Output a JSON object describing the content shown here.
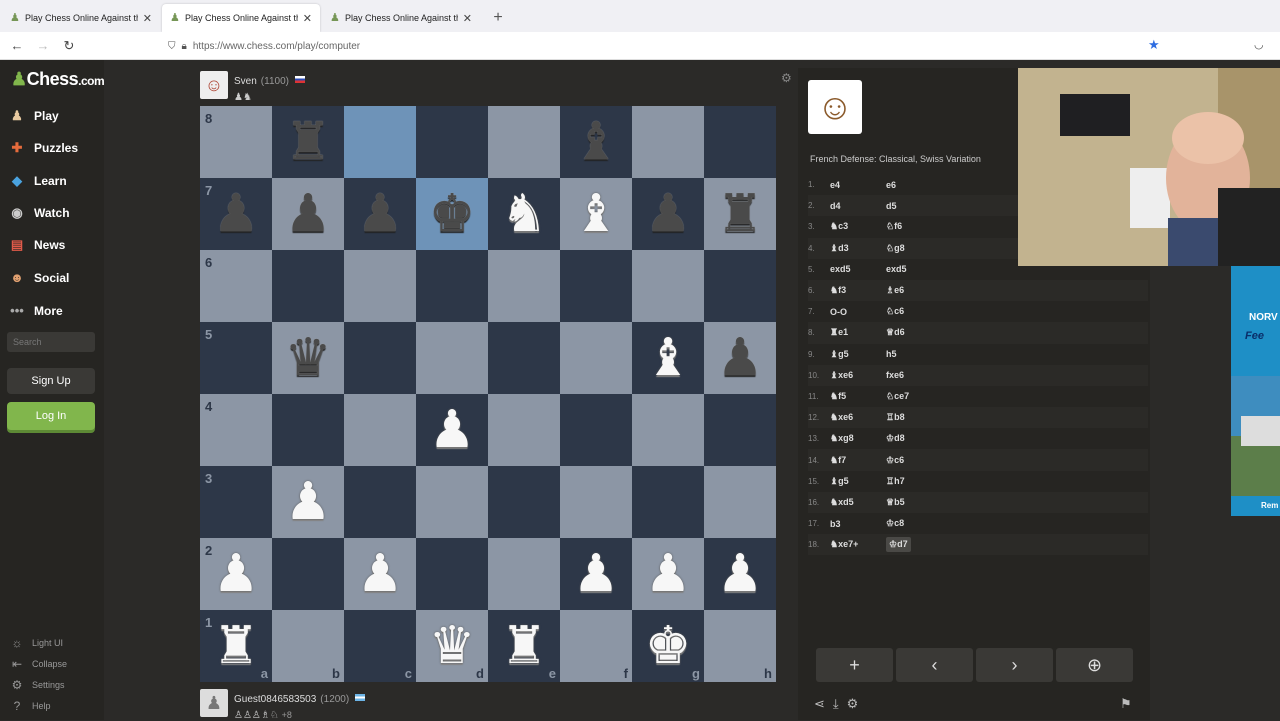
{
  "browser": {
    "tabs": [
      {
        "title": "Play Chess Online Against the C",
        "active": false
      },
      {
        "title": "Play Chess Online Against the C",
        "active": true
      },
      {
        "title": "Play Chess Online Against the C",
        "active": false
      }
    ],
    "url": "https://www.chess.com/play/computer"
  },
  "sidebar": {
    "logo": {
      "main": "Chess",
      "suffix": ".com"
    },
    "items": [
      {
        "label": "Play",
        "icon": "pawn-hand-icon"
      },
      {
        "label": "Puzzles",
        "icon": "puzzle-icon"
      },
      {
        "label": "Learn",
        "icon": "graduation-icon"
      },
      {
        "label": "Watch",
        "icon": "binoculars-icon"
      },
      {
        "label": "News",
        "icon": "newspaper-icon"
      },
      {
        "label": "Social",
        "icon": "people-icon"
      },
      {
        "label": "More",
        "icon": "more-dots-icon"
      }
    ],
    "search_placeholder": "Search",
    "signup_label": "Sign Up",
    "login_label": "Log In",
    "bottom": [
      "Light UI",
      "Collapse",
      "Settings",
      "Help"
    ]
  },
  "top_player": {
    "name": "Sven",
    "rating": "(1100)",
    "captured": "♟♞"
  },
  "bottom_player": {
    "name": "Guest0846583503",
    "rating": "(1200)",
    "captured": "♙♙♙♗♘",
    "advantage": "+8"
  },
  "board": {
    "ranks": [
      "8",
      "7",
      "6",
      "5",
      "4",
      "3",
      "2",
      "1"
    ],
    "files": [
      "a",
      "b",
      "c",
      "d",
      "e",
      "f",
      "g",
      "h"
    ],
    "position": [
      [
        "",
        "bR",
        "",
        "",
        "",
        "bB",
        "",
        ""
      ],
      [
        "bP",
        "bP",
        "bP",
        "bK",
        "wN",
        "wB",
        "bP",
        "bR"
      ],
      [
        "",
        "",
        "",
        "",
        "",
        "",
        "",
        ""
      ],
      [
        "",
        "bQ",
        "",
        "",
        "",
        "",
        "wB",
        "bP"
      ],
      [
        "",
        "",
        "",
        "wP",
        "",
        "",
        "",
        ""
      ],
      [
        "",
        "wP",
        "",
        "",
        "",
        "",
        "",
        ""
      ],
      [
        "wP",
        "",
        "wP",
        "",
        "",
        "wP",
        "wP",
        "wP"
      ],
      [
        "wR",
        "",
        "",
        "wQ",
        "wR",
        "",
        "wK",
        ""
      ]
    ],
    "highlight_squares": [
      "c8",
      "d7"
    ],
    "light_color": "#8c96a5",
    "dark_color": "#2d3748",
    "highlight_color": "#6e93b8"
  },
  "panel": {
    "opening": "French Defense: Classical, Swiss Variation",
    "moves": [
      {
        "n": "1.",
        "w": "e4",
        "b": "e6"
      },
      {
        "n": "2.",
        "w": "d4",
        "b": "d5"
      },
      {
        "n": "3.",
        "w": "♞c3",
        "b": "♘f6"
      },
      {
        "n": "4.",
        "w": "♝d3",
        "b": "♘g8"
      },
      {
        "n": "5.",
        "w": "exd5",
        "b": "exd5"
      },
      {
        "n": "6.",
        "w": "♞f3",
        "b": "♗e6"
      },
      {
        "n": "7.",
        "w": "O-O",
        "b": "♘c6"
      },
      {
        "n": "8.",
        "w": "♜e1",
        "b": "♕d6"
      },
      {
        "n": "9.",
        "w": "♝g5",
        "b": "h5"
      },
      {
        "n": "10.",
        "w": "♝xe6",
        "b": "fxe6"
      },
      {
        "n": "11.",
        "w": "♞f5",
        "b": "♘ce7"
      },
      {
        "n": "12.",
        "w": "♞xe6",
        "b": "♖b8"
      },
      {
        "n": "13.",
        "w": "♞xg8",
        "b": "♔d8"
      },
      {
        "n": "14.",
        "w": "♞f7",
        "b": "♔c6"
      },
      {
        "n": "15.",
        "w": "♝g5",
        "b": "♖h7"
      },
      {
        "n": "16.",
        "w": "♞xd5",
        "b": "♕b5"
      },
      {
        "n": "17.",
        "w": "b3",
        "b": "♔c8"
      },
      {
        "n": "18.",
        "w": "♞xe7+",
        "b": "♔d7"
      }
    ],
    "controls": [
      "+",
      "‹",
      "›",
      "⊕"
    ]
  },
  "ad": {
    "line1": "NORV",
    "line2": "Fee",
    "line3": "Rem"
  }
}
